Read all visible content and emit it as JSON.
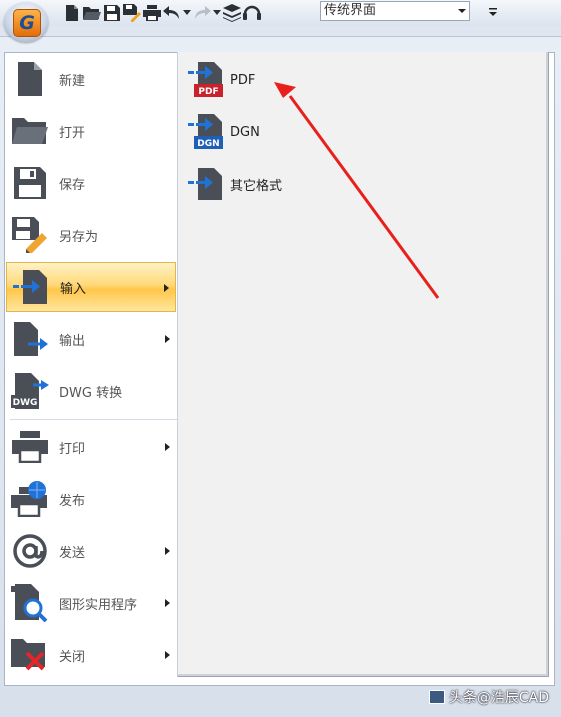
{
  "quick_access": {
    "icons": [
      "new-file-icon",
      "open-folder-icon",
      "save-icon",
      "save-as-icon",
      "print-icon",
      "undo-icon",
      "undo-dropdown-icon",
      "redo-icon",
      "redo-dropdown-icon",
      "layers-icon",
      "headset-icon"
    ],
    "workspace_value": "传统界面"
  },
  "menu": {
    "items": [
      {
        "label": "新建",
        "icon": "new-file-icon",
        "submenu": false
      },
      {
        "label": "打开",
        "icon": "open-folder-icon",
        "submenu": false
      },
      {
        "label": "保存",
        "icon": "save-icon",
        "submenu": false
      },
      {
        "label": "另存为",
        "icon": "save-as-icon",
        "submenu": false
      },
      {
        "label": "输入",
        "icon": "import-icon",
        "submenu": true,
        "active": true
      },
      {
        "label": "输出",
        "icon": "export-icon",
        "submenu": true
      },
      {
        "label": "DWG 转换",
        "icon": "dwg-convert-icon",
        "submenu": false
      },
      {
        "label": "打印",
        "icon": "print-icon",
        "submenu": true
      },
      {
        "label": "发布",
        "icon": "publish-icon",
        "submenu": false
      },
      {
        "label": "发送",
        "icon": "send-icon",
        "submenu": true
      },
      {
        "label": "图形实用程序",
        "icon": "drawing-utilities-icon",
        "submenu": true
      },
      {
        "label": "关闭",
        "icon": "close-file-icon",
        "submenu": true
      }
    ]
  },
  "submenu": {
    "items": [
      {
        "label": "PDF",
        "icon": "import-pdf-icon",
        "badge": "PDF"
      },
      {
        "label": "DGN",
        "icon": "import-dgn-icon",
        "badge": "DGN"
      },
      {
        "label": "其它格式",
        "icon": "import-other-icon"
      }
    ]
  },
  "icon_badges": {
    "dwg": "DWG"
  },
  "annotation": {
    "color": "#e8201c"
  },
  "watermark": {
    "text": "头条@浩辰CAD"
  },
  "colors": {
    "active_highlight": "#ffd97a",
    "icon_dark": "#4a4f57",
    "import_arrow": "#1f73d6",
    "pdf_red": "#c8222c",
    "dgn_blue": "#1f5fb8"
  }
}
